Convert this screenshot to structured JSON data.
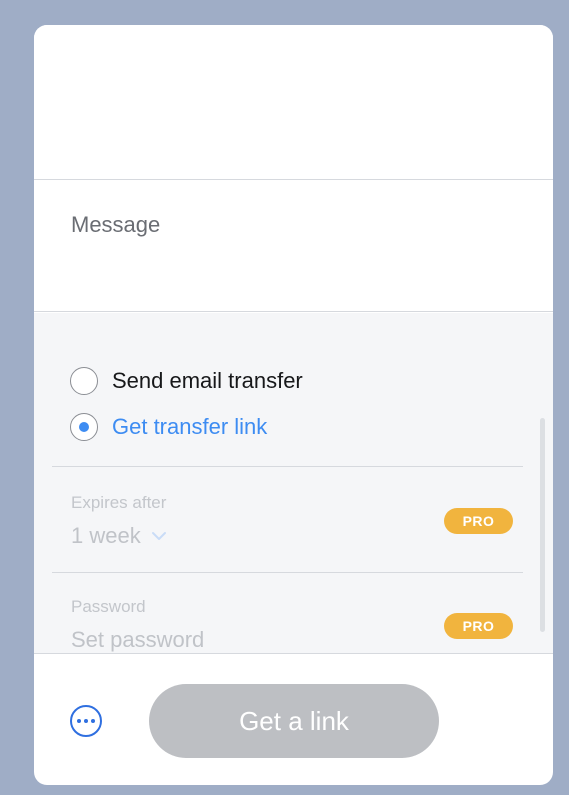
{
  "message": {
    "placeholder": "Message"
  },
  "transfer_mode": {
    "options": [
      {
        "label": "Send email transfer",
        "selected": false
      },
      {
        "label": "Get transfer link",
        "selected": true
      }
    ]
  },
  "expires": {
    "label": "Expires after",
    "value": "1 week",
    "badge": "PRO"
  },
  "password": {
    "label": "Password",
    "placeholder": "Set password",
    "badge": "PRO"
  },
  "footer": {
    "more_icon": "ellipsis-circle-icon",
    "primary_label": "Get a link"
  },
  "colors": {
    "accent": "#3d8cf2",
    "pro_badge": "#f1b43e",
    "disabled_button": "#bdbfc3"
  }
}
